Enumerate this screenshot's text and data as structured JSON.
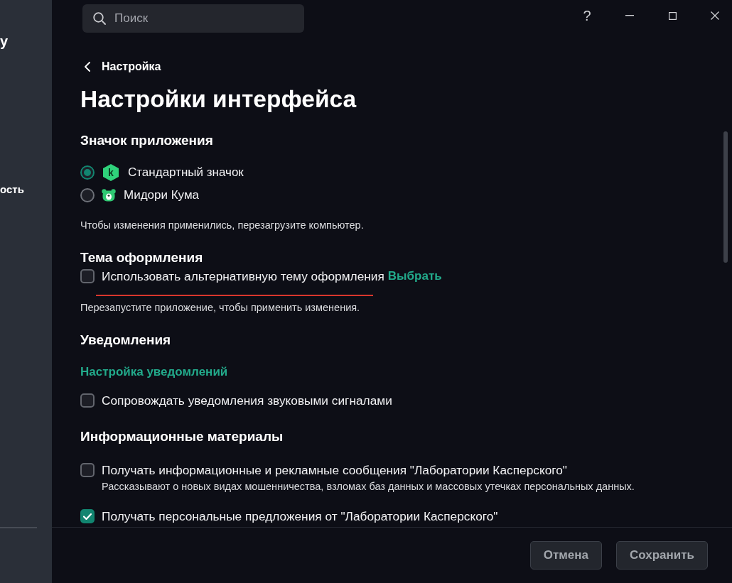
{
  "sidebar": {
    "items": [
      "у",
      "ость"
    ]
  },
  "search": {
    "placeholder": "Поиск"
  },
  "window_controls": {
    "help": "?"
  },
  "breadcrumb": "Настройка",
  "title": "Настройки интерфейса",
  "sections": [
    {
      "heading": "Значок приложения",
      "rows": [
        {
          "kind": "radio",
          "label": "Стандартный значок",
          "logo": "k",
          "selected": true
        },
        {
          "kind": "radio",
          "label": "Мидори Кума",
          "selected": false
        },
        {
          "kind": "note",
          "text": "Чтобы изменения применились, перезагрузите компьютер."
        }
      ]
    },
    {
      "heading": "Тема оформления",
      "rows": [
        {
          "kind": "checkbox",
          "label": "Использовать альтернативную тему оформления",
          "link": "Выбрать",
          "checked": false,
          "marked": true
        },
        {
          "kind": "note",
          "text": "Перезапустите приложение, чтобы применить изменения."
        }
      ]
    },
    {
      "heading": "Уведомления",
      "rows": [
        {
          "kind": "link",
          "text": "Настройка уведомлений"
        },
        {
          "kind": "checkbox",
          "label": "Сопровождать уведомления звуковыми сигналами",
          "checked": false
        }
      ]
    },
    {
      "heading": "Информационные материалы",
      "rows": [
        {
          "kind": "checkbox",
          "label": "Получать информационные и рекламные сообщения \"Лаборатории Касперского\"",
          "description": "Рассказывают о новых видах мошенничества, взломах баз данных и массовых утечках персональных данных.",
          "checked": false
        },
        {
          "kind": "checkbox",
          "label": "Получать персональные предложения от \"Лаборатории Касперского\"",
          "checked": true
        }
      ]
    }
  ],
  "footer": {
    "buttons": [
      "Отмена",
      "Сохранить"
    ]
  }
}
